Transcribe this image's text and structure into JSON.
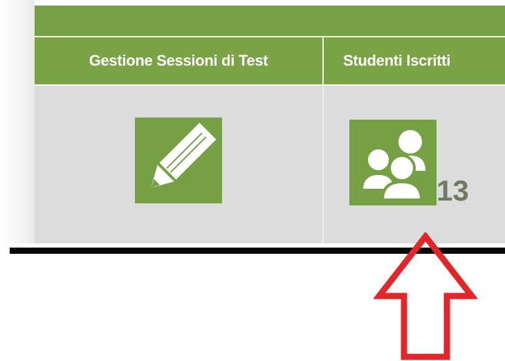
{
  "table": {
    "columns": [
      {
        "header": "Gestione Sessioni di Test",
        "icon": "edit-pencil-icon"
      },
      {
        "header": "Studenti Iscritti",
        "icon": "students-group-icon",
        "count": "13"
      }
    ]
  },
  "annotation": {
    "icon": "red-up-arrow",
    "color": "#e3262a"
  },
  "colors": {
    "header_green": "#7aa346",
    "icon_green": "#76a044",
    "cell_gray": "#dcdcdc",
    "count_text": "#6f7a63"
  }
}
